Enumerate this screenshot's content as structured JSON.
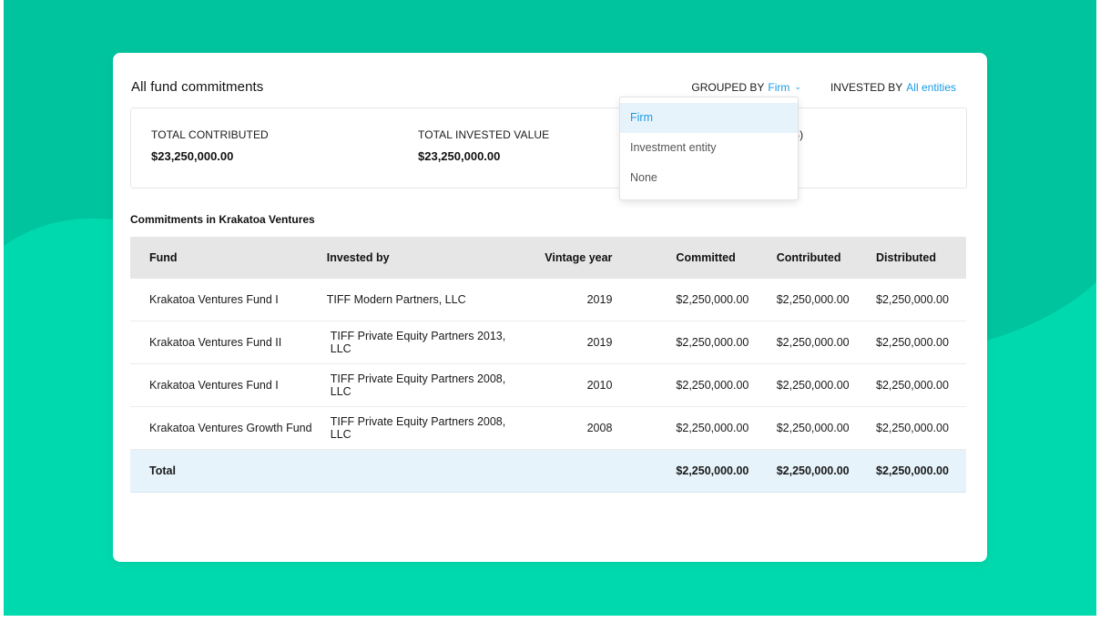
{
  "page": {
    "title": "All fund commitments"
  },
  "filters": {
    "grouped_by_label": "GROUPED BY",
    "grouped_by_value": "Firm",
    "invested_by_label": "INVESTED BY",
    "invested_by_value": "All entities"
  },
  "dropdown": {
    "options": [
      "Firm",
      "Investment entity",
      "None"
    ],
    "selected": "Firm"
  },
  "summary": {
    "stats": [
      {
        "label": "TOTAL CONTRIBUTED",
        "value": "$23,250,000.00"
      },
      {
        "label": "TOTAL INVESTED VALUE",
        "value": "$23,250,000.00"
      },
      {
        "label": "S)",
        "value": ""
      }
    ]
  },
  "section": {
    "title": "Commitments in Krakatoa Ventures"
  },
  "table": {
    "headers": [
      "Fund",
      "Invested by",
      "Vintage year",
      "Committed",
      "Contributed",
      "Distributed"
    ],
    "rows": [
      {
        "fund": "Krakatoa Ventures Fund I",
        "invested_by": "TIFF Modern Partners, LLC",
        "year": "2019",
        "committed": "$2,250,000.00",
        "contributed": "$2,250,000.00",
        "distributed": "$2,250,000.00"
      },
      {
        "fund": "Krakatoa Ventures Fund II",
        "invested_by": "TIFF Private Equity Partners 2013, LLC",
        "year": "2019",
        "committed": "$2,250,000.00",
        "contributed": "$2,250,000.00",
        "distributed": "$2,250,000.00"
      },
      {
        "fund": "Krakatoa Ventures Fund I",
        "invested_by": "TIFF Private Equity Partners 2008, LLC",
        "year": "2010",
        "committed": "$2,250,000.00",
        "contributed": "$2,250,000.00",
        "distributed": "$2,250,000.00"
      },
      {
        "fund": "Krakatoa Ventures Growth Fund",
        "invested_by": "TIFF Private Equity Partners 2008, LLC",
        "year": "2008",
        "committed": "$2,250,000.00",
        "contributed": "$2,250,000.00",
        "distributed": "$2,250,000.00"
      }
    ],
    "total": {
      "label": "Total",
      "committed": "$2,250,000.00",
      "contributed": "$2,250,000.00",
      "distributed": "$2,250,000.00"
    }
  },
  "colors": {
    "background": "#00d9ad",
    "background_wave": "#00c49d",
    "accent": "#1a9be6",
    "total_row": "#e6f3fb"
  }
}
